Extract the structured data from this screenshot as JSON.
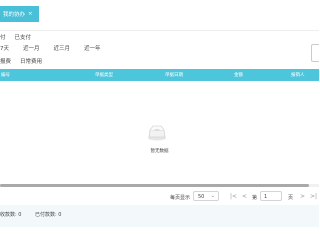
{
  "tab": {
    "label": "我的协办",
    "close": "×"
  },
  "filters": {
    "status": [
      "付",
      "已支付"
    ],
    "time": [
      "7天",
      "近一月",
      "近三月",
      "近一年"
    ],
    "cost_type": [
      "报费",
      "日常费用"
    ]
  },
  "table": {
    "columns": [
      "编号",
      "单据类型",
      "单据日期",
      "金额",
      "报销人"
    ],
    "empty_text": "暂无数据"
  },
  "pager": {
    "per_page_label": "每页显示",
    "per_page_value": "50",
    "prev_first": "|<",
    "prev": "<",
    "page_label": "第",
    "page_value": "1",
    "page_unit": "页",
    "next": ">",
    "next_last": ">|"
  },
  "footer": {
    "received_label": "收款数: 0",
    "paid_label": "已付款数: 0"
  }
}
